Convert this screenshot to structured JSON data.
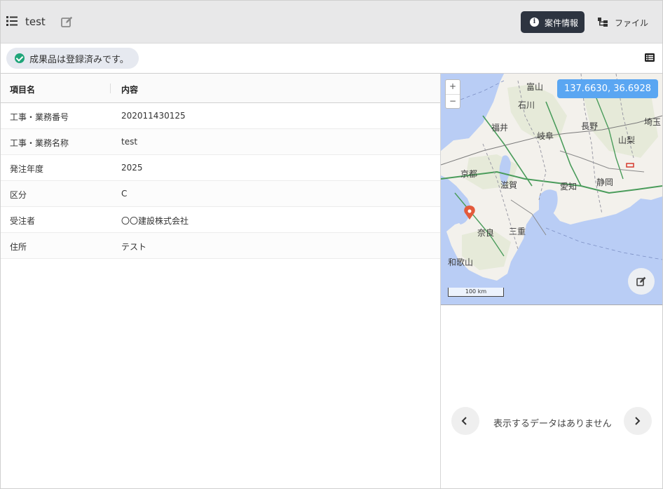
{
  "header": {
    "title": "test",
    "info_button": "案件情報",
    "file_button": "ファイル"
  },
  "status": {
    "message": "成果品は登録済みです。",
    "color": "#1fa57a"
  },
  "table": {
    "headers": [
      "項目名",
      "内容"
    ],
    "rows": [
      [
        "工事・業務番号",
        "202011430125"
      ],
      [
        "工事・業務名称",
        "test"
      ],
      [
        "発注年度",
        "2025"
      ],
      [
        "区分",
        "C"
      ],
      [
        "受注者",
        "〇〇建設株式会社"
      ],
      [
        "住所",
        "テスト"
      ]
    ]
  },
  "map": {
    "zoom_in": "+",
    "zoom_out": "−",
    "coordinates": "137.6630, 36.6928",
    "scale": "100 km",
    "labels": [
      "富山",
      "石川",
      "長野",
      "福井",
      "岐阜",
      "埼玉",
      "山梨",
      "京都",
      "滋賀",
      "愛知",
      "静岡",
      "奈良",
      "三重",
      "和歌山"
    ]
  },
  "gallery": {
    "empty_message": "表示するデータはありません"
  },
  "colors": {
    "header_bg": "#e8e8e9",
    "primary_button": "#2d3440",
    "coord_badge": "#5aa6f2",
    "map_water": "#b9cdf5"
  }
}
